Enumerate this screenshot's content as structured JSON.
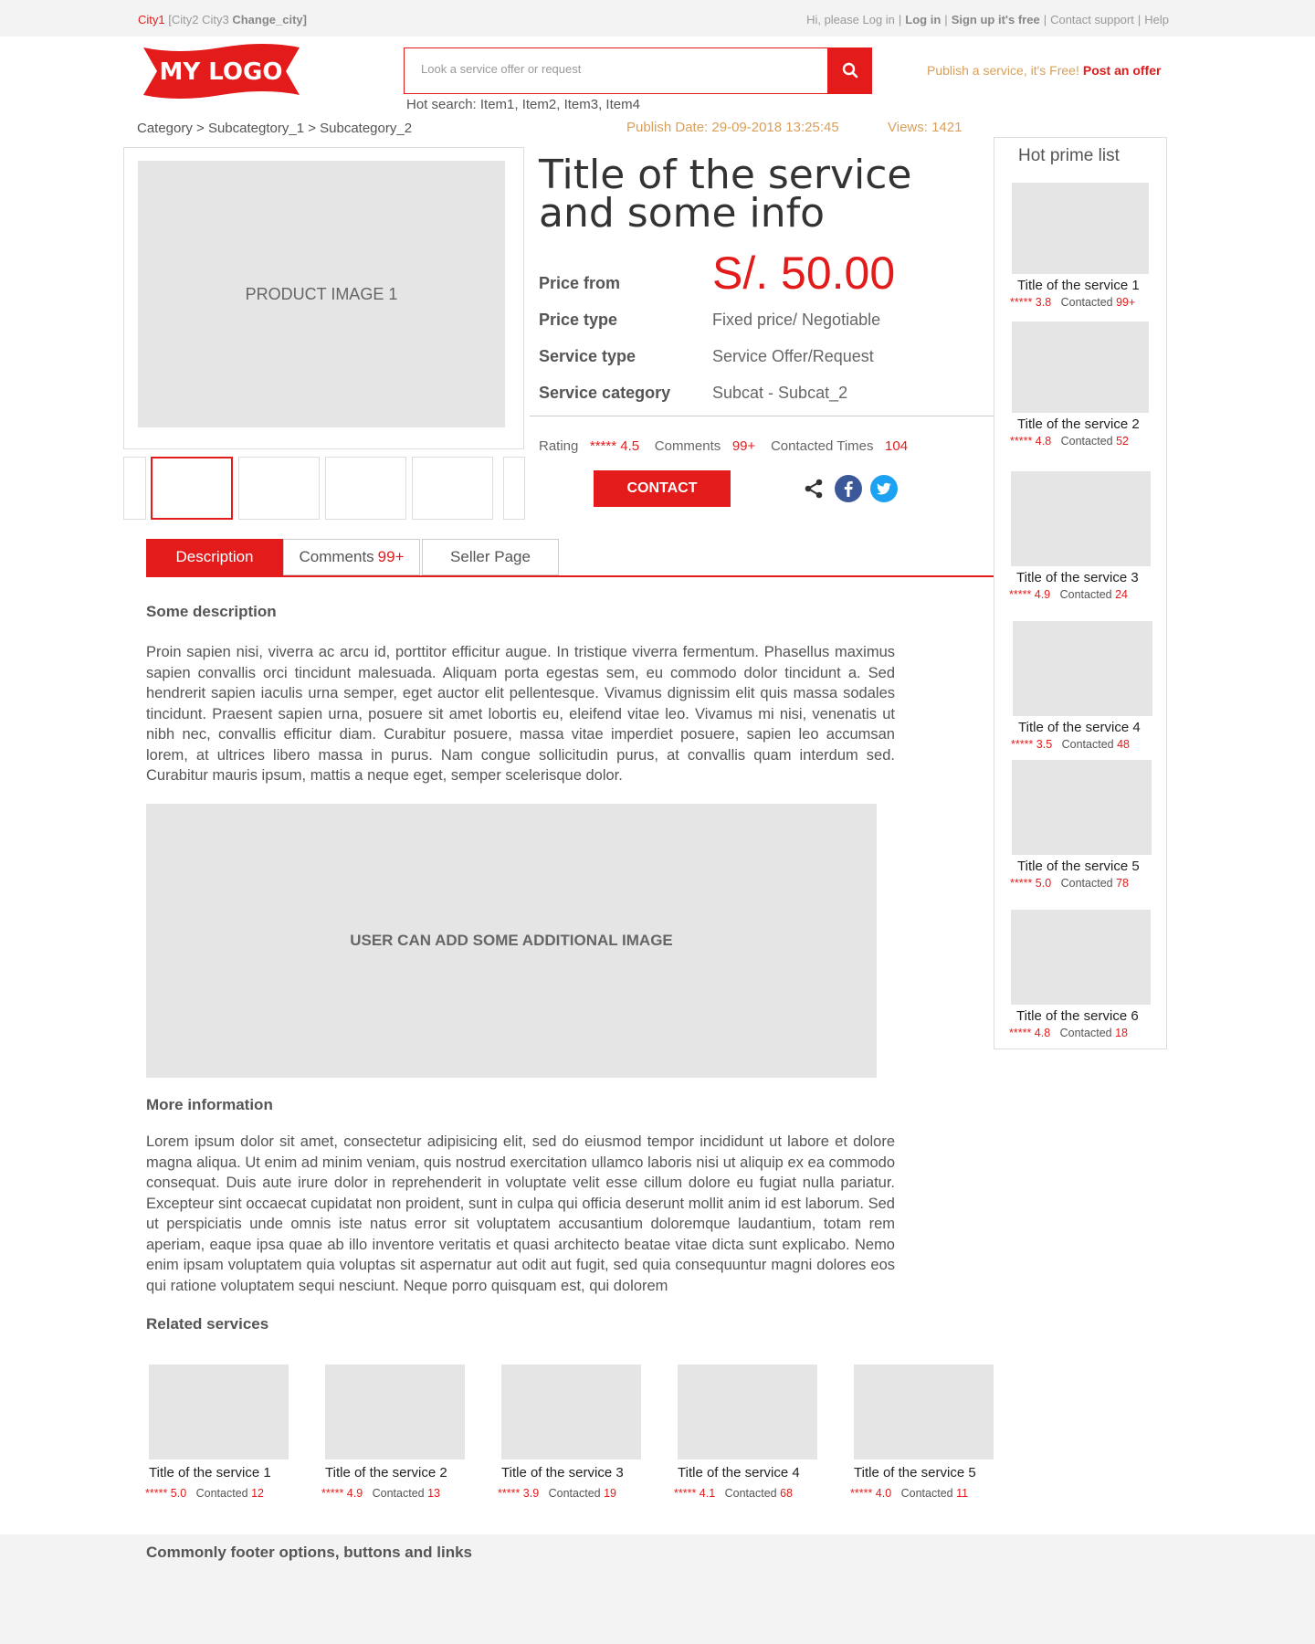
{
  "topbar": {
    "city_current": "City1",
    "city_others": "[City2  City3",
    "change_city": "Change_city]",
    "greeting": "Hi, please Log in",
    "login": "Log in",
    "signup": "Sign up it's free",
    "support": "Contact support",
    "help": "Help"
  },
  "header": {
    "logo_text": "MY LOGO",
    "search_placeholder": "Look a service offer or request",
    "hot_search": "Hot search: Item1, Item2, Item3, Item4",
    "publish_text": "Publish a service, it's Free!",
    "post_offer": "Post an offer"
  },
  "meta": {
    "breadcrumb": "Category > Subcategtory_1 > Subcategory_2",
    "publish_date": "Publish Date: 29-09-2018 13:25:45",
    "views": "Views: 1421"
  },
  "product": {
    "image_label": "PRODUCT IMAGE 1",
    "title": "Title of the service and some info",
    "price_label": "Price from",
    "price": "S/. 50.00",
    "price_type_label": "Price type",
    "price_type": "Fixed price/ Negotiable",
    "service_type_label": "Service type",
    "service_type": "Service Offer/Request",
    "category_label": "Service category",
    "category": "Subcat - Subcat_2",
    "rating_label": "Rating",
    "rating": "***** 4.5",
    "comments_label": "Comments",
    "comments": "99+",
    "contacted_label": "Contacted Times",
    "contacted": "104",
    "contact_button": "CONTACT"
  },
  "tabs": {
    "description": "Description",
    "comments": "Comments",
    "comments_count": "99+",
    "seller": "Seller Page"
  },
  "content": {
    "desc_heading": "Some description",
    "desc_text": "Proin sapien nisi, viverra ac arcu id, porttitor efficitur augue. In tristique viverra fermentum. Phasellus maximus sapien convallis orci tincidunt malesuada. Aliquam porta egestas sem, eu commodo dolor tincidunt a. Sed hendrerit sapien iaculis urna semper, eget auctor elit pellentesque. Vivamus dignissim elit quis massa sodales tincidunt. Praesent sapien urna, posuere sit amet lobortis eu, eleifend vitae leo. Vivamus mi nisi, venenatis ut nibh nec, convallis efficitur diam. Curabitur posuere, massa vitae imperdiet posuere, sapien leo accumsan lorem, at ultrices libero massa in purus. Nam congue sollicitudin purus, at convallis quam interdum sed. Curabitur mauris ipsum, mattis a neque eget, semper scelerisque dolor.",
    "additional_image": "USER CAN ADD SOME ADDITIONAL IMAGE",
    "more_heading": "More information",
    "more_text": "Lorem ipsum dolor sit amet, consectetur adipisicing elit, sed do eiusmod tempor incididunt ut labore et dolore magna aliqua. Ut enim ad minim veniam, quis nostrud exercitation ullamco laboris nisi ut aliquip ex ea commodo consequat. Duis aute irure dolor in reprehenderit in voluptate velit esse cillum dolore eu fugiat nulla pariatur. Excepteur sint occaecat cupidatat non proident, sunt in culpa qui officia deserunt mollit anim id est laborum. Sed ut perspiciatis unde omnis iste natus error sit voluptatem accusantium doloremque laudantium, totam rem aperiam, eaque ipsa quae ab illo inventore veritatis et quasi architecto beatae vitae dicta sunt explicabo. Nemo enim ipsam voluptatem quia voluptas sit aspernatur aut odit aut fugit, sed quia consequuntur magni dolores eos qui ratione voluptatem sequi nesciunt. Neque porro quisquam est, qui dolorem",
    "related_heading": "Related services"
  },
  "sidebar": {
    "title": "Hot prime list",
    "contacted_label": "Contacted",
    "items": [
      {
        "title": "Title of the service 1",
        "stars": "***** 3.8",
        "contacted": "99+"
      },
      {
        "title": "Title of the service 2",
        "stars": "***** 4.8",
        "contacted": "52"
      },
      {
        "title": "Title of the service 3",
        "stars": "***** 4.9",
        "contacted": "24"
      },
      {
        "title": "Title of the service 4",
        "stars": "***** 3.5",
        "contacted": "48"
      },
      {
        "title": "Title of the service 5",
        "stars": "***** 5.0",
        "contacted": "78"
      },
      {
        "title": "Title of the service 6",
        "stars": "***** 4.8",
        "contacted": "18"
      }
    ]
  },
  "related": {
    "contacted_label": "Contacted",
    "items": [
      {
        "title": "Title of the service 1",
        "stars": "***** 5.0",
        "contacted": "12"
      },
      {
        "title": "Title of the service 2",
        "stars": "***** 4.9",
        "contacted": "13"
      },
      {
        "title": "Title of the service 3",
        "stars": "***** 3.9",
        "contacted": "19"
      },
      {
        "title": "Title of the service 4",
        "stars": "***** 4.1",
        "contacted": "68"
      },
      {
        "title": "Title of the service 5",
        "stars": "***** 4.0",
        "contacted": "11"
      }
    ]
  },
  "footer": {
    "text": "Commonly footer options, buttons and links"
  },
  "colors": {
    "accent": "#e31b1b",
    "muted_gold": "#d9a05b",
    "placeholder_gray": "#e5e5e5"
  },
  "icons": [
    "search-icon",
    "share-icon",
    "facebook-icon",
    "twitter-icon"
  ]
}
